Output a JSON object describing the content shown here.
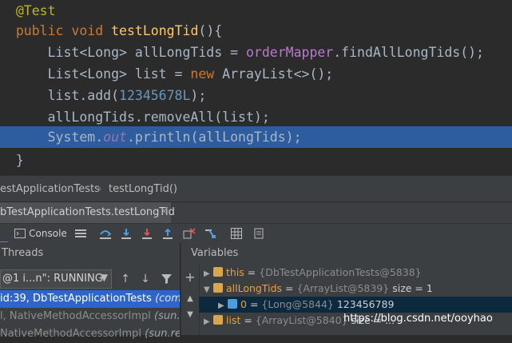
{
  "code": {
    "annotation": "@Test",
    "method_kw1": "public",
    "method_kw2": "void",
    "method_name": "testLongTid",
    "method_sig_rest": "(){",
    "line3_a": "List<Long> allLongTids = ",
    "line3_mapper": "orderMapper",
    "line3_b": ".findAllLongTids();",
    "line4_a": "List<Long> list = ",
    "line4_kw": "new",
    "line4_b": " ArrayList<>();",
    "line5_a": "list.add(",
    "line5_num": "12345678L",
    "line5_b": ");",
    "line6": "allLongTids.removeAll(list);",
    "line7_a": "System.",
    "line7_fld": "out",
    "line7_b": ".println(allLongTids);",
    "close_brace": "}"
  },
  "breadcrumb": {
    "first": "estApplicationTests",
    "separator": "›",
    "second": "testLongTid()"
  },
  "session": {
    "tab_label": "bTestApplicationTests.testLongTid",
    "close_glyph": "×"
  },
  "toolbar": {
    "console_label": "Console",
    "colors": {
      "blue": "#4a9fe0",
      "red": "#e05555",
      "grey": "#bbbbbb"
    }
  },
  "threads": {
    "header": "Threads",
    "selected_thread": "@1 i...n\": RUNNING",
    "frames": [
      {
        "text": "id:39, DbTestApplicationTests",
        "pkg": "(com.oo"
      },
      {
        "text": "l, NativeMethodAccessorImpl",
        "pkg": "(sun.refle"
      },
      {
        "text": "NativeMethodAccessorImpl",
        "pkg": "(sun.refle"
      }
    ]
  },
  "variables": {
    "header": "Variables",
    "rows": [
      {
        "name": "this",
        "ref": "{DbTestApplicationTests@5838}",
        "extra": ""
      },
      {
        "name": "allLongTids",
        "ref": "{ArrayList@5839}",
        "extra": "size = 1"
      },
      {
        "name": "0",
        "ref": "{Long@5844}",
        "extra": "123456789"
      },
      {
        "name": "list",
        "ref": "{ArrayList@5840}",
        "extra": "size = ..."
      }
    ]
  },
  "watermark": "https://blog.csdn.net/ooyhao"
}
